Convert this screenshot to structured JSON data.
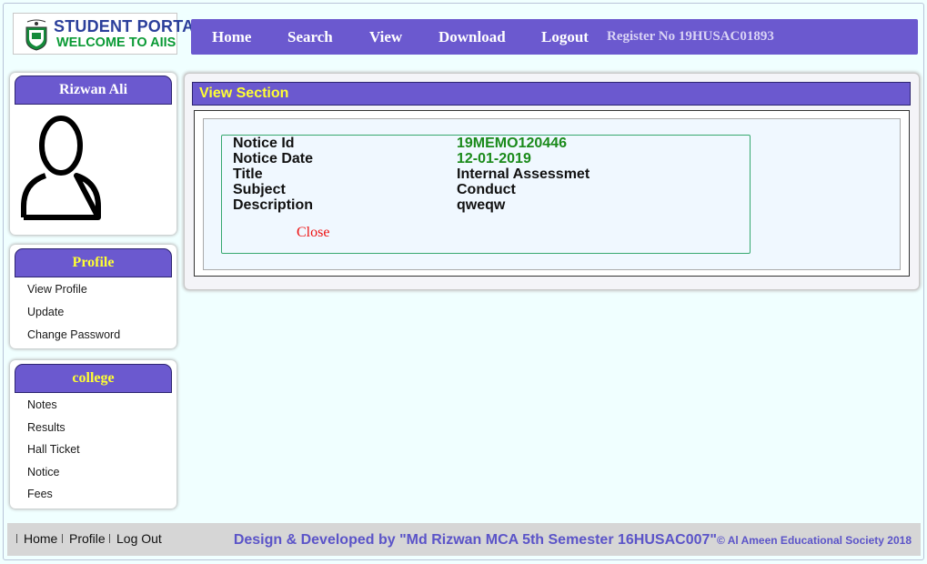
{
  "logo": {
    "line1": "STUDENT PORTAL",
    "line2": "WELCOME TO AIIS"
  },
  "nav": {
    "items": [
      "Home",
      "Search",
      "View",
      "Download",
      "Logout"
    ],
    "register": "Register No 19HUSAC01893"
  },
  "user": {
    "name": "Rizwan Ali",
    "avatar_icon": "user-silhouette-icon"
  },
  "profile_menu": {
    "title": "Profile",
    "items": [
      "View Profile",
      "Update",
      "Change Password"
    ]
  },
  "college_menu": {
    "title": "college",
    "items": [
      "Notes",
      "Results",
      "Hall Ticket",
      "Notice",
      "Fees"
    ]
  },
  "view_section": {
    "title": "View Section",
    "fields": [
      {
        "label": "Notice Id",
        "value": "19MEMO120446",
        "value_color": "#1a8a1a"
      },
      {
        "label": "Notice Date",
        "value": "12-01-2019",
        "value_color": "#1a8a1a"
      },
      {
        "label": "Title",
        "value": "Internal Assessmet",
        "value_color": "#111111"
      },
      {
        "label": "Subject",
        "value": "Conduct",
        "value_color": "#111111"
      },
      {
        "label": "Description",
        "value": "qweqw",
        "value_color": "#111111"
      }
    ],
    "close_label": "Close"
  },
  "footer": {
    "links": [
      "Home",
      "Profile",
      "Log Out"
    ],
    "credit": "Design & Developed by \"Md Rizwan MCA 5th Semester 16HUSAC007\"",
    "copyright": "© Al Ameen Educational Society 2018"
  },
  "colors": {
    "accent": "#6b59cf",
    "heading_yellow": "#ffff33",
    "background": "#f0ffff"
  }
}
